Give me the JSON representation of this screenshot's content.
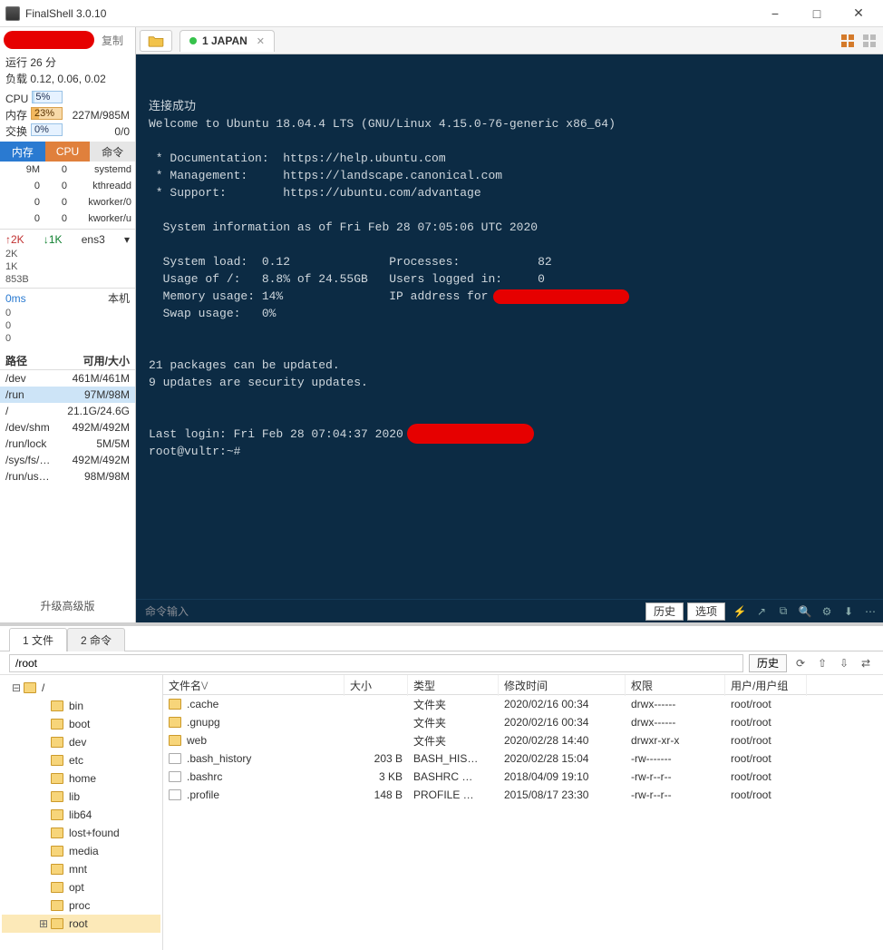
{
  "window": {
    "title": "FinalShell 3.0.10",
    "minimize": "−",
    "maximize": "□",
    "close": "✕"
  },
  "left": {
    "copy_hint": "复制",
    "runtime_label": "运行 26 分",
    "load_label": "负载 0.12, 0.06, 0.02",
    "cpu_label": "CPU",
    "cpu_pct": "5%",
    "mem_label": "内存",
    "mem_pct": "23%",
    "mem_text": "227M/985M",
    "swap_label": "交换",
    "swap_pct": "0%",
    "swap_text": "0/0",
    "tab_mem": "内存",
    "tab_cpu": "CPU",
    "tab_cmd": "命令",
    "procs": [
      {
        "m": "9M",
        "c": "0",
        "name": "systemd"
      },
      {
        "m": "0",
        "c": "0",
        "name": "kthreadd"
      },
      {
        "m": "0",
        "c": "0",
        "name": "kworker/0"
      },
      {
        "m": "0",
        "c": "0",
        "name": "kworker/u"
      }
    ],
    "net_up": "2K",
    "net_down": "1K",
    "net_if": "ens3",
    "net_scale": [
      "2K",
      "1K",
      "853B"
    ],
    "lat": "0ms",
    "lat_host": "本机",
    "lat_scale": [
      "0",
      "0",
      "0"
    ],
    "fs_head_path": "路径",
    "fs_head_size": "可用/大小",
    "fs": [
      {
        "p": "/dev",
        "s": "461M/461M"
      },
      {
        "p": "/run",
        "s": "97M/98M"
      },
      {
        "p": "/",
        "s": "21.1G/24.6G"
      },
      {
        "p": "/dev/shm",
        "s": "492M/492M"
      },
      {
        "p": "/run/lock",
        "s": "5M/5M"
      },
      {
        "p": "/sys/fs/…",
        "s": "492M/492M"
      },
      {
        "p": "/run/us…",
        "s": "98M/98M"
      }
    ],
    "upgrade": "升级高级版"
  },
  "tabs": {
    "name": "1 JAPAN"
  },
  "terminal": {
    "lines": [
      "连接成功",
      "Welcome to Ubuntu 18.04.4 LTS (GNU/Linux 4.15.0-76-generic x86_64)",
      "",
      " * Documentation:  https://help.ubuntu.com",
      " * Management:     https://landscape.canonical.com",
      " * Support:        https://ubuntu.com/advantage",
      "",
      "  System information as of Fri Feb 28 07:05:06 UTC 2020",
      "",
      "  System load:  0.12              Processes:           82",
      "  Usage of /:   8.8% of 24.55GB   Users logged in:     0",
      "  Memory usage: 14%               IP address for ens3: ",
      "  Swap usage:   0%",
      "",
      "",
      "21 packages can be updated.",
      "9 updates are security updates.",
      "",
      "",
      "Last login: Fri Feb 28 07:04:37 2020 from ",
      "root@vultr:~# "
    ],
    "input_placeholder": "命令输入",
    "btn_history": "历史",
    "btn_options": "选项"
  },
  "files": {
    "tab1": "1 文件",
    "tab2": "2 命令",
    "path": "/root",
    "history": "历史",
    "tree": [
      "/",
      "bin",
      "boot",
      "dev",
      "etc",
      "home",
      "lib",
      "lib64",
      "lost+found",
      "media",
      "mnt",
      "opt",
      "proc",
      "root"
    ],
    "cols": {
      "name": "文件名",
      "size": "大小",
      "type": "类型",
      "mtime": "修改时间",
      "perm": "权限",
      "owner": "用户/用户组"
    },
    "rows": [
      {
        "n": ".cache",
        "size": "",
        "type": "文件夹",
        "mtime": "2020/02/16 00:34",
        "perm": "drwx------",
        "own": "root/root",
        "folder": true
      },
      {
        "n": ".gnupg",
        "size": "",
        "type": "文件夹",
        "mtime": "2020/02/16 00:34",
        "perm": "drwx------",
        "own": "root/root",
        "folder": true
      },
      {
        "n": "web",
        "size": "",
        "type": "文件夹",
        "mtime": "2020/02/28 14:40",
        "perm": "drwxr-xr-x",
        "own": "root/root",
        "folder": true
      },
      {
        "n": ".bash_history",
        "size": "203 B",
        "type": "BASH_HIS…",
        "mtime": "2020/02/28 15:04",
        "perm": "-rw-------",
        "own": "root/root",
        "folder": false
      },
      {
        "n": ".bashrc",
        "size": "3 KB",
        "type": "BASHRC …",
        "mtime": "2018/04/09 19:10",
        "perm": "-rw-r--r--",
        "own": "root/root",
        "folder": false
      },
      {
        "n": ".profile",
        "size": "148 B",
        "type": "PROFILE …",
        "mtime": "2015/08/17 23:30",
        "perm": "-rw-r--r--",
        "own": "root/root",
        "folder": false
      }
    ]
  }
}
